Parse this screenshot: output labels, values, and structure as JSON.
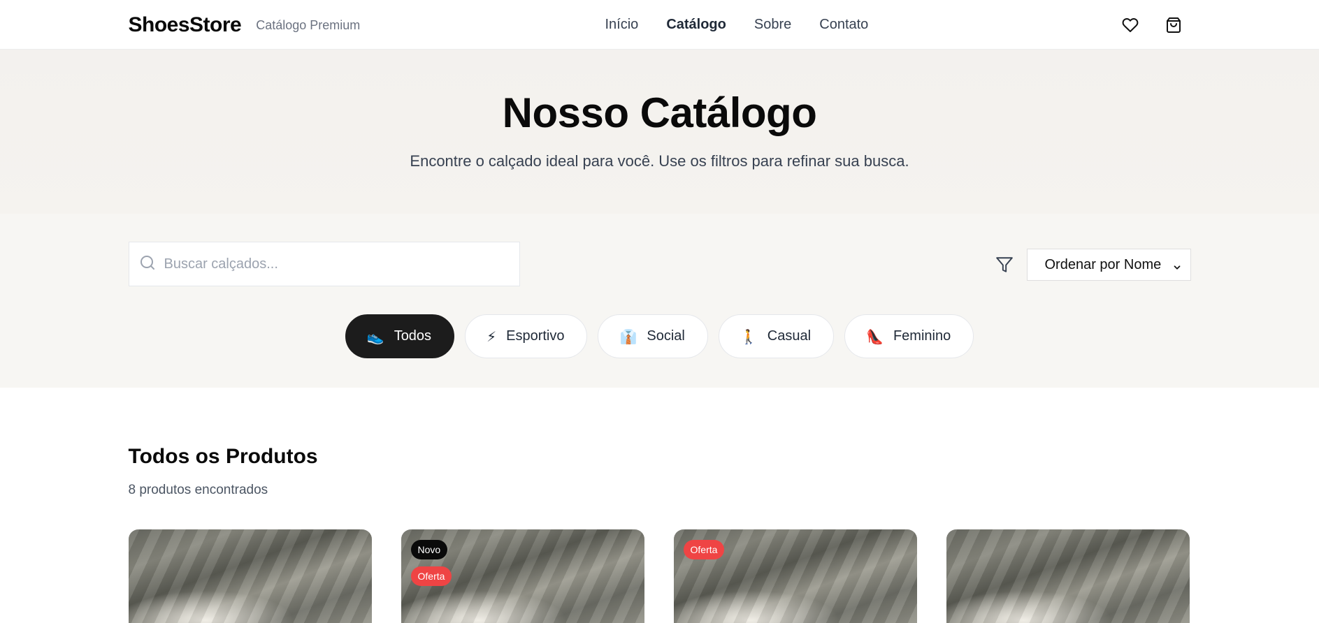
{
  "header": {
    "brand": "ShoesStore",
    "subtitle": "Catálogo Premium",
    "nav": [
      {
        "label": "Início",
        "active": false
      },
      {
        "label": "Catálogo",
        "active": true
      },
      {
        "label": "Sobre",
        "active": false
      },
      {
        "label": "Contato",
        "active": false
      }
    ],
    "icons": [
      "heart-icon",
      "shopping-bag-icon"
    ]
  },
  "hero": {
    "title": "Nosso Catálogo",
    "description": "Encontre o calçado ideal para você. Use os filtros para refinar sua busca."
  },
  "filters": {
    "search_placeholder": "Buscar calçados...",
    "search_value": "",
    "sort_selected": "Ordenar por Nome",
    "categories": [
      {
        "emoji": "👟",
        "label": "Todos",
        "active": true
      },
      {
        "emoji": "⚡",
        "label": "Esportivo",
        "active": false
      },
      {
        "emoji": "👔",
        "label": "Social",
        "active": false
      },
      {
        "emoji": "🚶",
        "label": "Casual",
        "active": false
      },
      {
        "emoji": "👠",
        "label": "Feminino",
        "active": false
      }
    ]
  },
  "products": {
    "title": "Todos os Produtos",
    "count_text": "8 produtos encontrados",
    "cards": [
      {
        "badges": []
      },
      {
        "badges": [
          {
            "text": "Novo",
            "type": "new"
          },
          {
            "text": "Oferta",
            "type": "sale"
          }
        ]
      },
      {
        "badges": [
          {
            "text": "Oferta",
            "type": "sale"
          }
        ]
      },
      {
        "badges": []
      }
    ]
  },
  "colors": {
    "accent_dark": "#1c1c1c",
    "sale_badge": "#ef4444",
    "new_badge": "#0a0a0a",
    "hero_bg": "#f3f1ee"
  }
}
